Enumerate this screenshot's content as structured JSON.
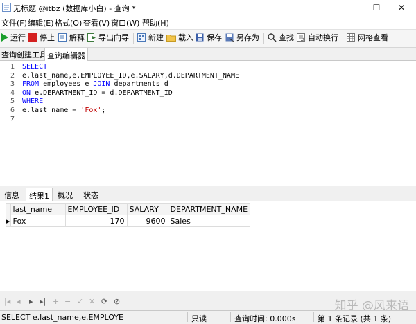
{
  "window": {
    "title": "无标题 @itbz (数据库小白) - 查询 *",
    "minimize": "—",
    "maximize": "☐",
    "close": "✕"
  },
  "menu": [
    "文件(F)",
    "编辑(E)",
    "格式(O)",
    "查看(V)",
    "窗口(W)",
    "帮助(H)"
  ],
  "toolbar": {
    "run": "运行",
    "stop": "停止",
    "explain": "解释",
    "export_wizard": "导出向导",
    "new": "新建",
    "load": "载入",
    "save": "保存",
    "save_as": "另存为",
    "find": "查找",
    "wrap": "自动换行",
    "grid_view": "网格查看"
  },
  "subtabs": [
    "查询创建工具",
    "查询编辑器"
  ],
  "editor": {
    "lines": [
      {
        "n": "1",
        "parts": [
          {
            "t": "SELECT",
            "k": "kw"
          }
        ]
      },
      {
        "n": "2",
        "parts": [
          {
            "t": "e.last_name,e.EMPLOYEE_ID,e.SALARY,d.DEPARTMENT_NAME",
            "k": ""
          }
        ]
      },
      {
        "n": "3",
        "parts": [
          {
            "t": "FROM",
            "k": "kw"
          },
          {
            "t": " employees e ",
            "k": ""
          },
          {
            "t": "JOIN",
            "k": "kw"
          },
          {
            "t": " departments d",
            "k": ""
          }
        ]
      },
      {
        "n": "4",
        "parts": [
          {
            "t": "ON",
            "k": "kw"
          },
          {
            "t": " e.DEPARTMENT_ID = d.DEPARTMENT_ID",
            "k": ""
          }
        ]
      },
      {
        "n": "5",
        "parts": [
          {
            "t": "WHERE",
            "k": "kw"
          }
        ]
      },
      {
        "n": "6",
        "parts": [
          {
            "t": "e.last_name = ",
            "k": ""
          },
          {
            "t": "'Fox'",
            "k": "str"
          },
          {
            "t": ";",
            "k": ""
          }
        ]
      },
      {
        "n": "7",
        "parts": []
      }
    ]
  },
  "result_tabs": [
    "信息",
    "结果1",
    "概况",
    "状态"
  ],
  "result": {
    "columns": [
      "last_name",
      "EMPLOYEE_ID",
      "SALARY",
      "DEPARTMENT_NAME"
    ],
    "rows": [
      [
        "Fox",
        "170",
        "9600",
        "Sales"
      ]
    ]
  },
  "nav_icons": [
    "|◂",
    "◂",
    "▸",
    "▸|",
    "+",
    "−",
    "✓",
    "✕",
    "⟳",
    "⊘"
  ],
  "status": {
    "sql": "SELECT e.last_name,e.EMPLOYE",
    "mode": "只读",
    "query_time": "查询时间: 0.000s",
    "records": "第 1 条记录 (共 1 条)"
  },
  "watermark": "知乎 @风来语",
  "colors": {
    "keyword": "#0000ff",
    "string": "#c00000",
    "run_green": "#1a9e2c",
    "stop_red": "#d42020"
  }
}
